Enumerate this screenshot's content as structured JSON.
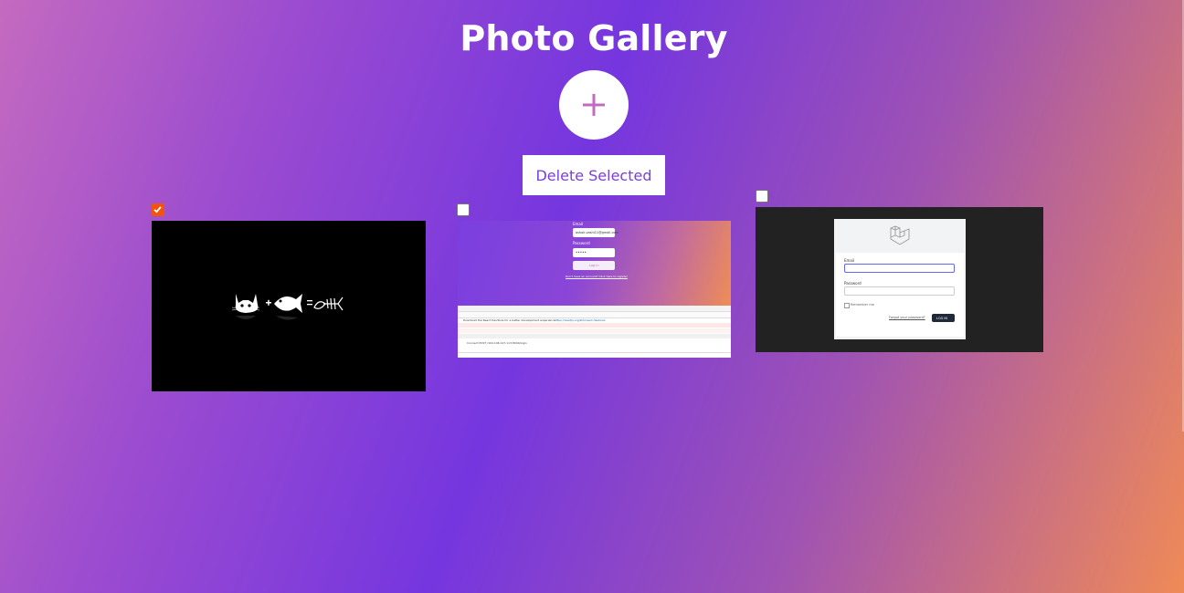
{
  "page": {
    "title": "Photo Gallery",
    "add_button_symbol": "+",
    "delete_label": "Delete Selected"
  },
  "colors": {
    "accent": "#c46ac0",
    "delete_text": "#7a3fd6",
    "checkbox_checked": "#f2540e"
  },
  "gallery": [
    {
      "checked": true,
      "icon": "cat-plus-fish-equals-bones"
    },
    {
      "checked": false,
      "screenshot": {
        "email_label": "Email",
        "email_value": "ashok.vashi11@gmail.com",
        "password_label": "Password",
        "password_value": "•••••",
        "login_label": "Log in",
        "forgot_text": "Don't have an account? Click here to register",
        "console_message": "Download the React DevTools for a better development experience",
        "console_url": "https://reactjs.org/link/react-devtools",
        "request_line": "Connect POST /104.196.127.113:8000/login"
      }
    },
    {
      "checked": false,
      "screenshot": {
        "email_label": "Email",
        "password_label": "Password",
        "remember_label": "Remember me",
        "forgot_link": "Forgot your password?",
        "login_button": "LOG IN"
      }
    }
  ]
}
